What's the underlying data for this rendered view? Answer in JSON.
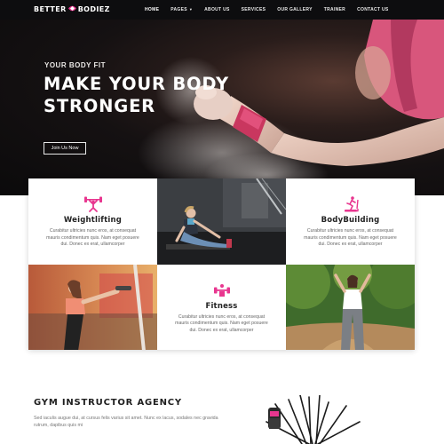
{
  "brand": {
    "logo_left": "BETTER",
    "logo_right": "BODIEZ",
    "accent": "#e8368f"
  },
  "nav": {
    "items": [
      {
        "label": "HOME"
      },
      {
        "label": "PAGES"
      },
      {
        "label": "ABOUT US"
      },
      {
        "label": "SERVICES"
      },
      {
        "label": "OUR GALLERY"
      },
      {
        "label": "TRAINER"
      },
      {
        "label": "CONTACT US"
      }
    ]
  },
  "hero": {
    "eyebrow": "YOUR BODY FIT",
    "title_line1": "MAKE YOUR BODY",
    "title_line2": "STRONGER",
    "button": "Join Us Now"
  },
  "cards": {
    "weightlifting": {
      "title": "Weightlifting",
      "text": "Curabitur ultricies nunc eros, at consequat mauris condimentum quis. Nam eget posuere dui. Donec ex erat, ullamcorper",
      "icon": "barbell-lift-icon"
    },
    "bodybuilding": {
      "title": "BodyBuilding",
      "text": "Curabitur ultricies nunc eros, at consequat mauris condimentum quis. Nam eget posuere dui. Donec ex erat, ullamcorper",
      "icon": "treadmill-icon"
    },
    "fitness": {
      "title": "Fitness",
      "text": "Curabitur ultricies nunc eros, at consequat mauris condimentum quis. Nam eget posuere dui. Donec ex erat, ullamcorper",
      "icon": "dumbbell-icon"
    }
  },
  "agency": {
    "title": "GYM INSTRUCTOR AGENCY",
    "text": "Sed iaculis augue dui, at cursus felis varius sit amet. Nunc ex lacus, sodales nec gravida rutrum, dapibus quis mi"
  }
}
